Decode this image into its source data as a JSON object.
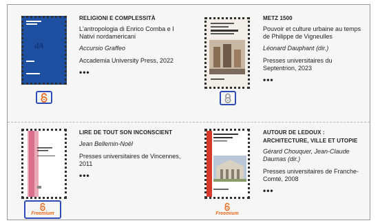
{
  "books": [
    {
      "series": "RELIGIONI E COMPLESSITÀ",
      "title": "L'antropologia di Enrico Comba e I Nativi nordamericani",
      "author": "Accursio Graffeo",
      "publisher": "Accademia University Press, 2022",
      "more": "•••",
      "access_icon": "open-access-icon",
      "access_label": ""
    },
    {
      "series": "METZ 1500",
      "title": "Pouvoir et culture urbaine au temps de Philippe de Vigneulles",
      "author": "Léonard Dauphant (dir.)",
      "publisher": "Presses universitaires du Septentrion, 2023",
      "more": "•••",
      "access_icon": "closed-access-icon",
      "access_label": ""
    },
    {
      "series": "LIRE DE TOUT SON INCONSCIENT",
      "title": "",
      "author": "Jean Bellemin-Noël",
      "publisher": "Presses universitaires de Vincennes, 2011",
      "more": "•••",
      "access_icon": "open-access-icon",
      "access_label": "Freemium"
    },
    {
      "series": "AUTOUR DE LEDOUX : ARCHITECTURE, VILLE ET UTOPIE",
      "title": "",
      "author": "Gérard Chouquer, Jean-Claude Daumas (dir.)",
      "publisher": "Presses universitaires de Franche-Comté, 2008",
      "more": "•••",
      "access_icon": "open-access-icon",
      "access_label": "Freemium"
    }
  ],
  "colors": {
    "accent_blue": "#2f4bb7",
    "open_access_orange": "#e86a1f",
    "lock_grey": "#9a9a9a"
  }
}
